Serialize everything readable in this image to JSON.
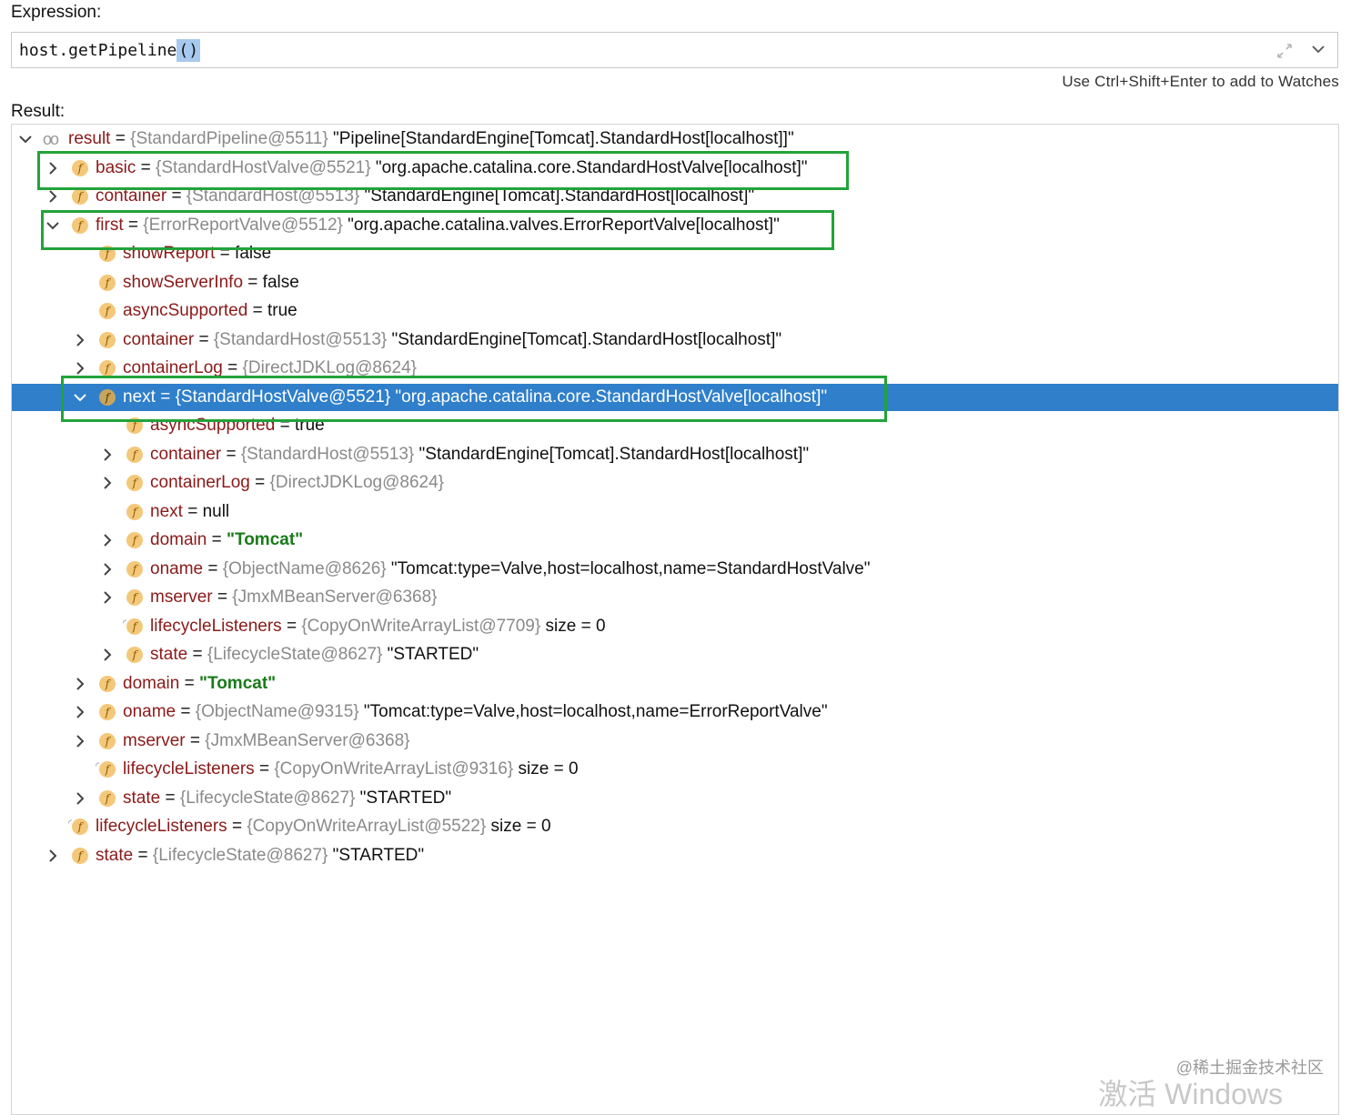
{
  "expression": {
    "label": "Expression:",
    "code": "host.getPipeline",
    "code_selected": "()",
    "hint": "Use Ctrl+Shift+Enter to add to Watches"
  },
  "result_label": "Result:",
  "tree": [
    {
      "indent": 0,
      "arrow": "down",
      "icon": "oo",
      "name": "result",
      "sep": " = ",
      "ref": "{StandardPipeline@5511}",
      "val": " \"Pipeline[StandardEngine[Tomcat].StandardHost[localhost]]\"",
      "style": "plain"
    },
    {
      "indent": 1,
      "arrow": "right",
      "icon": "f",
      "name": "basic",
      "sep": " = ",
      "ref": "{StandardHostValve@5521}",
      "val": " \"org.apache.catalina.core.StandardHostValve[localhost]\"",
      "style": "plain"
    },
    {
      "indent": 1,
      "arrow": "right",
      "icon": "f",
      "name": "container",
      "sep": " = ",
      "ref": "{StandardHost@5513}",
      "val": " \"StandardEngine[Tomcat].StandardHost[localhost]\"",
      "style": "plain"
    },
    {
      "indent": 1,
      "arrow": "down",
      "icon": "f",
      "name": "first",
      "sep": " = ",
      "ref": "{ErrorReportValve@5512}",
      "val": " \"org.apache.catalina.valves.ErrorReportValve[localhost]\"",
      "style": "plain"
    },
    {
      "indent": 2,
      "arrow": "none",
      "icon": "f",
      "name": "showReport",
      "sep": " = ",
      "ref": "",
      "val": "false",
      "style": "plain"
    },
    {
      "indent": 2,
      "arrow": "none",
      "icon": "f",
      "name": "showServerInfo",
      "sep": " = ",
      "ref": "",
      "val": "false",
      "style": "plain"
    },
    {
      "indent": 2,
      "arrow": "none",
      "icon": "f",
      "name": "asyncSupported",
      "sep": " = ",
      "ref": "",
      "val": "true",
      "style": "plain"
    },
    {
      "indent": 2,
      "arrow": "right",
      "icon": "f",
      "name": "container",
      "sep": " = ",
      "ref": "{StandardHost@5513}",
      "val": " \"StandardEngine[Tomcat].StandardHost[localhost]\"",
      "style": "plain"
    },
    {
      "indent": 2,
      "arrow": "right",
      "icon": "f",
      "name": "containerLog",
      "sep": " = ",
      "ref": "{DirectJDKLog@8624}",
      "val": "",
      "style": "plain"
    },
    {
      "indent": 2,
      "arrow": "down",
      "icon": "f",
      "name": "next",
      "sep": " = ",
      "ref": "{StandardHostValve@5521}",
      "val": " \"org.apache.catalina.core.StandardHostValve[localhost]\"",
      "style": "plain",
      "selected": true
    },
    {
      "indent": 3,
      "arrow": "none",
      "icon": "f",
      "name": "asyncSupported",
      "sep": " = ",
      "ref": "",
      "val": "true",
      "style": "plain"
    },
    {
      "indent": 3,
      "arrow": "right",
      "icon": "f",
      "name": "container",
      "sep": " = ",
      "ref": "{StandardHost@5513}",
      "val": " \"StandardEngine[Tomcat].StandardHost[localhost]\"",
      "style": "plain"
    },
    {
      "indent": 3,
      "arrow": "right",
      "icon": "f",
      "name": "containerLog",
      "sep": " = ",
      "ref": "{DirectJDKLog@8624}",
      "val": "",
      "style": "plain"
    },
    {
      "indent": 3,
      "arrow": "none",
      "icon": "f",
      "name": "next",
      "sep": " = ",
      "ref": "",
      "val": "null",
      "style": "plain"
    },
    {
      "indent": 3,
      "arrow": "right",
      "icon": "f",
      "name": "domain",
      "sep": " = ",
      "ref": "",
      "val": "\"Tomcat\"",
      "style": "string"
    },
    {
      "indent": 3,
      "arrow": "right",
      "icon": "f",
      "name": "oname",
      "sep": " = ",
      "ref": "{ObjectName@8626}",
      "val": " \"Tomcat:type=Valve,host=localhost,name=StandardHostValve\"",
      "style": "plain"
    },
    {
      "indent": 3,
      "arrow": "right",
      "icon": "f",
      "name": "mserver",
      "sep": " = ",
      "ref": "{JmxMBeanServer@6368}",
      "val": "",
      "style": "plain"
    },
    {
      "indent": 3,
      "arrow": "none",
      "icon": "f-final",
      "name": "lifecycleListeners",
      "sep": " = ",
      "ref": "{CopyOnWriteArrayList@7709}",
      "val": "  size = 0",
      "style": "plain"
    },
    {
      "indent": 3,
      "arrow": "right",
      "icon": "f",
      "name": "state",
      "sep": " = ",
      "ref": "{LifecycleState@8627}",
      "val": " \"STARTED\"",
      "style": "plain"
    },
    {
      "indent": 2,
      "arrow": "right",
      "icon": "f",
      "name": "domain",
      "sep": " = ",
      "ref": "",
      "val": "\"Tomcat\"",
      "style": "string"
    },
    {
      "indent": 2,
      "arrow": "right",
      "icon": "f",
      "name": "oname",
      "sep": " = ",
      "ref": "{ObjectName@9315}",
      "val": " \"Tomcat:type=Valve,host=localhost,name=ErrorReportValve\"",
      "style": "plain"
    },
    {
      "indent": 2,
      "arrow": "right",
      "icon": "f",
      "name": "mserver",
      "sep": " = ",
      "ref": "{JmxMBeanServer@6368}",
      "val": "",
      "style": "plain"
    },
    {
      "indent": 2,
      "arrow": "none",
      "icon": "f-final",
      "name": "lifecycleListeners",
      "sep": " = ",
      "ref": "{CopyOnWriteArrayList@9316}",
      "val": "  size = 0",
      "style": "plain"
    },
    {
      "indent": 2,
      "arrow": "right",
      "icon": "f",
      "name": "state",
      "sep": " = ",
      "ref": "{LifecycleState@8627}",
      "val": " \"STARTED\"",
      "style": "plain"
    },
    {
      "indent": 1,
      "arrow": "none",
      "icon": "f-final",
      "name": "lifecycleListeners",
      "sep": " = ",
      "ref": "{CopyOnWriteArrayList@5522}",
      "val": "  size = 0",
      "style": "plain"
    },
    {
      "indent": 1,
      "arrow": "right",
      "icon": "f",
      "name": "state",
      "sep": " = ",
      "ref": "{LifecycleState@8627}",
      "val": " \"STARTED\"",
      "style": "plain"
    }
  ],
  "watermark": {
    "line1": "@稀土掘金技术社区",
    "line2": "激活 Windows"
  },
  "colors": {
    "highlight_box": "#22a33a",
    "selection": "#2f7fcb",
    "field_name": "#8b1a1a",
    "reference": "#8a8a8a",
    "string_value": "#1a7a1a"
  }
}
